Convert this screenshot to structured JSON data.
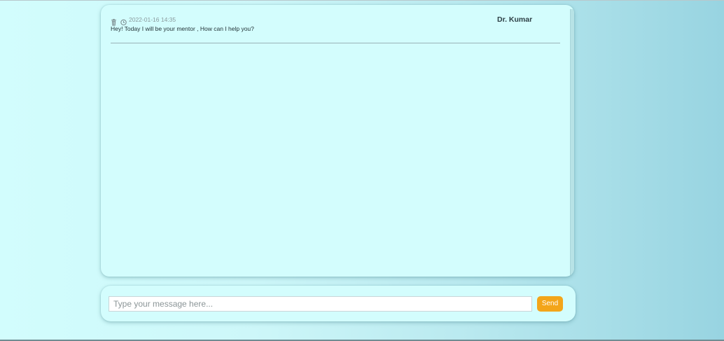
{
  "chat": {
    "messages": [
      {
        "timestamp": "2022-01-16 14:35",
        "sender": "Dr. Kumar",
        "text": "Hey! Today I will be your mentor , How can I help you?",
        "icons": [
          "trash-icon",
          "clock-icon"
        ]
      }
    ]
  },
  "composer": {
    "placeholder": "Type your message here...",
    "value": "",
    "send_label": "Send",
    "send_color": "#f3a51a"
  },
  "colors": {
    "panel_bg": "#d3fdfd",
    "sender_text": "#2c3e44",
    "timestamp_text": "#8a9a9d"
  }
}
